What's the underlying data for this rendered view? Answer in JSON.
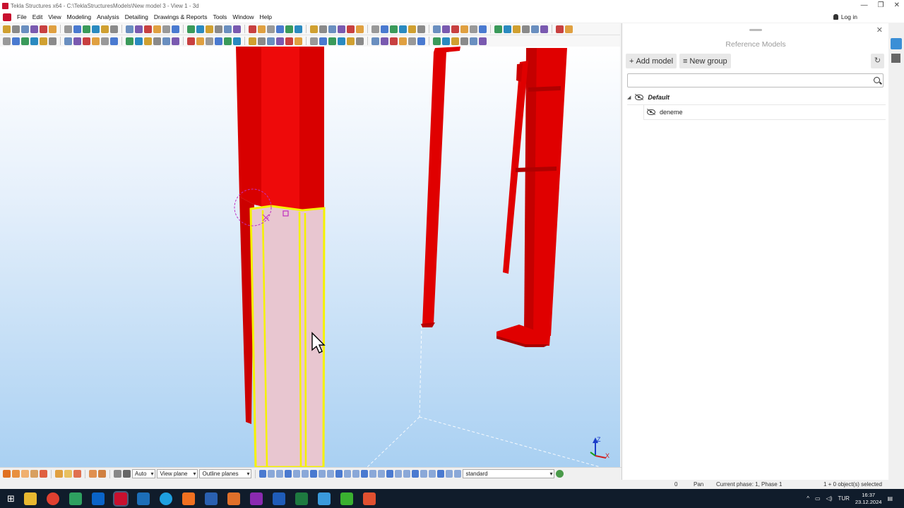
{
  "window": {
    "title": "Tekla Structures x64 - C:\\TeklaStructuresModels\\New model 3 - View 1 - 3d",
    "login_label": "Log in",
    "minimize": "—",
    "restore": "❐",
    "close": "✕"
  },
  "menu": {
    "items": [
      "File",
      "Edit",
      "View",
      "Modeling",
      "Analysis",
      "Detailing",
      "Drawings & Reports",
      "Tools",
      "Window",
      "Help"
    ]
  },
  "colors": {
    "accent": "#c8102e",
    "member_red": "#e00000",
    "selected_outline": "#f5f200",
    "selected_fill": "#e8c6d0"
  },
  "bottom_toolbar": {
    "select_mode": "Auto",
    "snap_plane": "View plane",
    "planes": "Outline planes",
    "filter": "standard"
  },
  "status": {
    "count": "0",
    "mode": "Pan",
    "phase": "Current phase: 1, Phase 1",
    "selection": "1 + 0 object(s) selected"
  },
  "panel": {
    "title": "Reference Models",
    "add_model": "Add model",
    "new_group": "New group",
    "search_placeholder": "",
    "groups": [
      {
        "name": "Default",
        "models": [
          "deneme"
        ]
      }
    ]
  },
  "axis": {
    "z_label": "Z",
    "x_label": "X"
  },
  "taskbar": {
    "language": "TUR",
    "time": "16:37",
    "date": "23.12.2024"
  }
}
